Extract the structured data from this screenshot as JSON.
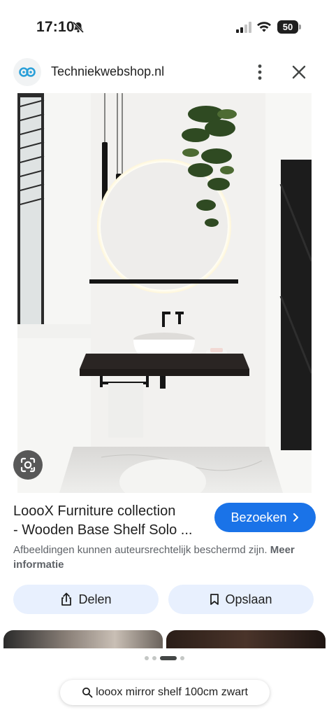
{
  "status_bar": {
    "time": "17:10",
    "battery": "50"
  },
  "site": {
    "name": "Techniekwebshop.nl",
    "logo_icon": "techniekwebshop-logo"
  },
  "result": {
    "title_line1": "LoooX Furniture collection",
    "title_line2": "- Wooden Base Shelf Solo ...",
    "visit_label": "Bezoeken",
    "copyright_text": "Afbeeldingen kunnen auteursrechtelijk beschermd zijn.",
    "more_info_label": "Meer informatie"
  },
  "actions": {
    "share_label": "Delen",
    "save_label": "Opslaan"
  },
  "pager": {
    "count": 4,
    "active_index": 2
  },
  "search": {
    "query": "looox mirror shelf 100cm zwart"
  },
  "colors": {
    "accent": "#1a73e8",
    "chip_bg": "#e8f0fe",
    "text": "#1f1f1f",
    "muted": "#5f6368"
  }
}
